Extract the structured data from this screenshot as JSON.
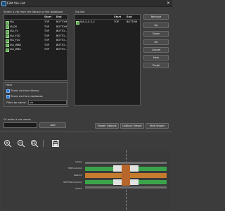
{
  "window": {
    "title": "Edit Via List",
    "close": "✕"
  },
  "library": {
    "label": "Select a via from the library or the database",
    "headers": {
      "name": "",
      "start": "Start",
      "end": "End"
    },
    "rows": [
      {
        "name": "VIA",
        "start": "TOP",
        "end": "BOTTOM"
      },
      {
        "name": "VIA20",
        "start": "TOP",
        "end": "BOTTOM"
      },
      {
        "name": "VIA_FC",
        "start": "TOP",
        "end": "BOTTO..."
      },
      {
        "name": "VIA_FCD",
        "start": "TOP",
        "end": "BOTTO..."
      },
      {
        "name": "VIA_FCS",
        "start": "TOP",
        "end": "BOTTO..."
      },
      {
        "name": "VIA_WBD",
        "start": "TOP",
        "end": "BOTTO..."
      },
      {
        "name": "VIA_WBS",
        "start": "TOP",
        "end": "BOTTO..."
      }
    ]
  },
  "vialist": {
    "label": "Via list:",
    "headers": {
      "name": "",
      "start": "Start",
      "end": "End"
    },
    "rows": [
      {
        "name": "VIA-3_0-3_2",
        "start": "TOP",
        "end": "BOTTOM"
      }
    ]
  },
  "side_buttons": [
    "Remove",
    "Up",
    "Down",
    "OK",
    "Cancel",
    "Help",
    "Purge"
  ],
  "filter": {
    "title": "Filter",
    "show_library": "Show via from library",
    "show_database": "Show via from database",
    "by_name_label": "Filter by name:",
    "by_name_value": "via"
  },
  "enter": {
    "label": "Or enter a via name:",
    "value": "",
    "add_button": "Add"
  },
  "viewer_buttons": {
    "options": "Viewer Options",
    "unblock": "Unblock Viewer",
    "hide": "Hide Viewer"
  },
  "viewer": {
    "toolbar": [
      "zoom-in",
      "zoom-out",
      "zoom-fit",
      "save"
    ],
    "layers": [
      "Surface",
      "TOP(Conductor)",
      "Dielectric",
      "BOTTOM(Conductor)",
      "Surface"
    ]
  },
  "colors": {
    "conductor": "#3ba44b",
    "dielectric": "#c47b2d",
    "drill": "#b7662c",
    "pad": "#e2e3e0"
  }
}
